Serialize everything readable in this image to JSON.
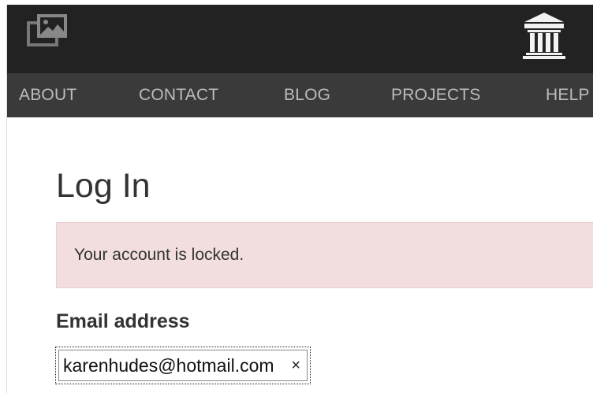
{
  "header": {
    "logo_icon": "pictures-icon",
    "institution_icon": "building-columns-icon"
  },
  "nav": {
    "items": [
      {
        "label": "ABOUT"
      },
      {
        "label": "CONTACT"
      },
      {
        "label": "BLOG"
      },
      {
        "label": "PROJECTS"
      },
      {
        "label": "HELP"
      }
    ]
  },
  "page": {
    "title": "Log In"
  },
  "alert": {
    "message": "Your account is locked.",
    "background": "#f2dede"
  },
  "form": {
    "email_label": "Email address",
    "email_value": "karenhudes@hotmail.com",
    "clear_icon": "close-icon",
    "clear_glyph": "×"
  }
}
